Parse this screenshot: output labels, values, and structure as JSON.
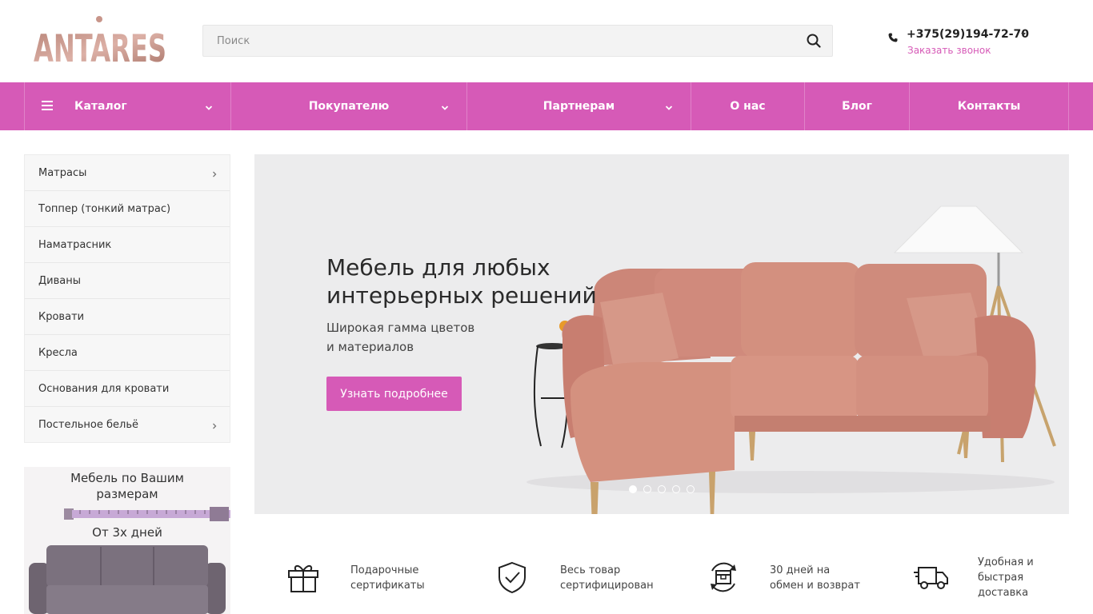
{
  "brand": {
    "logo_text": "ANTARES"
  },
  "search": {
    "placeholder": "Поиск"
  },
  "contact": {
    "phone": "+375(29)194-72-70",
    "callback_label": "Заказать звонок"
  },
  "nav": {
    "items": [
      {
        "label": "Каталог"
      },
      {
        "label": "Покупателю"
      },
      {
        "label": "Партнерам"
      },
      {
        "label": "О нас"
      },
      {
        "label": "Блог"
      },
      {
        "label": "Контакты"
      }
    ]
  },
  "sidebar": {
    "items": [
      {
        "label": "Матрасы"
      },
      {
        "label": "Топпер (тонкий матрас)"
      },
      {
        "label": "Наматрасник"
      },
      {
        "label": "Диваны"
      },
      {
        "label": "Кровати"
      },
      {
        "label": "Кресла"
      },
      {
        "label": "Основания для кровати"
      },
      {
        "label": "Постельное бельё"
      }
    ]
  },
  "promo": {
    "line1": "Мебель по Вашим",
    "line2": "размерам",
    "days": "От 3х дней"
  },
  "banner": {
    "title_line1": "Мебель для любых",
    "title_line2": "интерьерных решений",
    "subtitle_line1": "Широкая гамма цветов",
    "subtitle_line2": "и материалов",
    "button_label": "Узнать подробнее"
  },
  "features": [
    {
      "line1": "Подарочные",
      "line2": "сертификаты",
      "line3": "",
      "icon": "gift-icon"
    },
    {
      "line1": "Весь товар",
      "line2": "сертифицирован",
      "line3": "",
      "icon": "shield-check-icon"
    },
    {
      "line1": "30 дней на",
      "line2": "обмен и возврат",
      "line3": "",
      "icon": "return-box-icon"
    },
    {
      "line1": "Удобная и",
      "line2": "быстрая",
      "line3": "доставка",
      "icon": "delivery-truck-icon"
    }
  ],
  "colors": {
    "accent": "#d65ab7",
    "logo": "#c8958a"
  }
}
